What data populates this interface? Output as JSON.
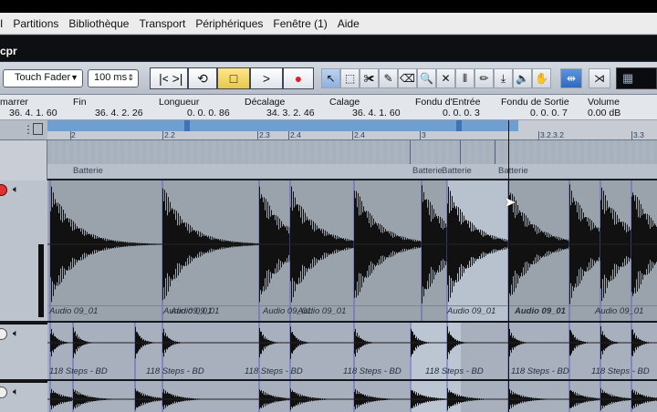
{
  "menu": [
    "I",
    "Partitions",
    "Bibliothèque",
    "Transport",
    "Périphériques",
    "Fenêtre (1)",
    "Aide"
  ],
  "window_title": "cpr",
  "toolbar": {
    "automation_mode": "Touch Fader",
    "latency": "100 ms",
    "transport": {
      "rewind_icon": "|<",
      "forward_icon": ">|",
      "cycle_icon": "⟲",
      "stop_icon": "□",
      "play_icon": ">",
      "record_icon": "●"
    },
    "tools": [
      "↖",
      "⬚",
      "✀",
      "✎",
      "⌫",
      "🔍",
      "✕",
      "⫴",
      "✏",
      "⤓",
      "🔈",
      "✋"
    ]
  },
  "info_line": {
    "labels": [
      "marrer",
      "Fin",
      "Longueur",
      "Décalage",
      "Calage",
      "Fondu d'Entrée",
      "Fondu de Sortie",
      "Volume"
    ],
    "values": [
      "36. 4. 1. 60",
      "36. 4. 2. 26",
      "0. 0. 0. 86",
      "34. 3. 2. 46",
      "36. 4. 1. 60",
      "0. 0. 0.   3",
      "0. 0. 0.   7",
      "0.00 dB"
    ]
  },
  "ruler": {
    "labels": [
      "2",
      "2.2",
      "2.3",
      "2.4",
      "3",
      "3.2.3.2",
      "3.3"
    ]
  },
  "folder_events": [
    "Batterie",
    "Batterie",
    "Batterie",
    "Batterie"
  ],
  "track1_events": [
    "Audio 09_01",
    "Audio 09_01",
    "Audio 09_01",
    "Audio 09_01",
    "Audio 09_01",
    "Audio 09_01",
    "Audio 09_01",
    "Audio 09_01"
  ],
  "track2_events": [
    "118 Steps - BD",
    "118 Steps - BD",
    "118 Steps - BD",
    "118 Steps - BD",
    "118 Steps - BD",
    "118 Steps - BD",
    "118 Steps - BD"
  ],
  "colors": {
    "accent": "#6f9fd0",
    "selection": "#b9c4d4",
    "record": "#d22"
  }
}
